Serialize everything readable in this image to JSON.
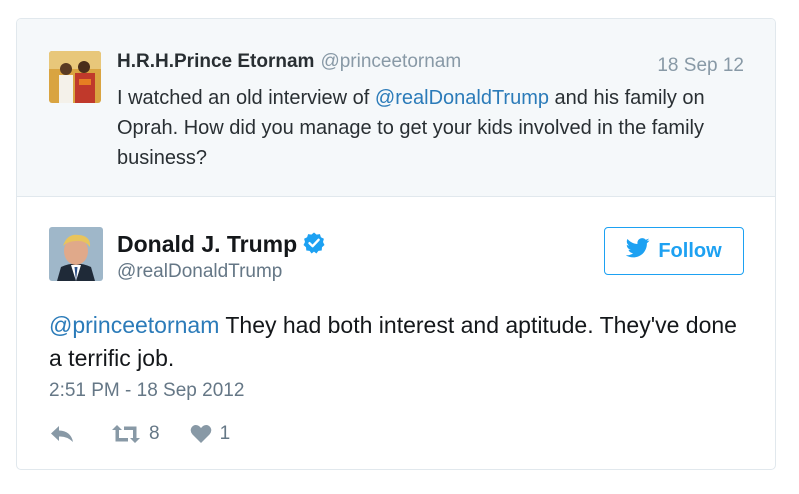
{
  "parent_tweet": {
    "author_name": "H.R.H.Prince Etornam",
    "author_handle": "@princeetornam",
    "date": "18 Sep 12",
    "text_before": "I watched an old interview of ",
    "mention": "@realDonaldTrump",
    "text_after": " and his family on Oprah. How did you manage to get your kids involved in the family business?"
  },
  "tweet": {
    "author_name": "Donald J. Trump",
    "author_handle": "@realDonaldTrump",
    "follow_label": "Follow",
    "mention": "@princeetornam",
    "text": " They had both interest and aptitude. They've done a terrific job.",
    "timestamp": "2:51 PM - 18 Sep 2012",
    "retweet_count": "8",
    "like_count": "1"
  },
  "colors": {
    "link": "#2b7bb9",
    "follow_blue": "#1da1f2",
    "verified_blue": "#1da1f2",
    "muted": "#8899a6",
    "parent_background": "#f5f8fa"
  },
  "icons": [
    "reply-icon",
    "retweet-icon",
    "heart-icon",
    "twitter-bird-icon",
    "verified-badge-icon"
  ]
}
